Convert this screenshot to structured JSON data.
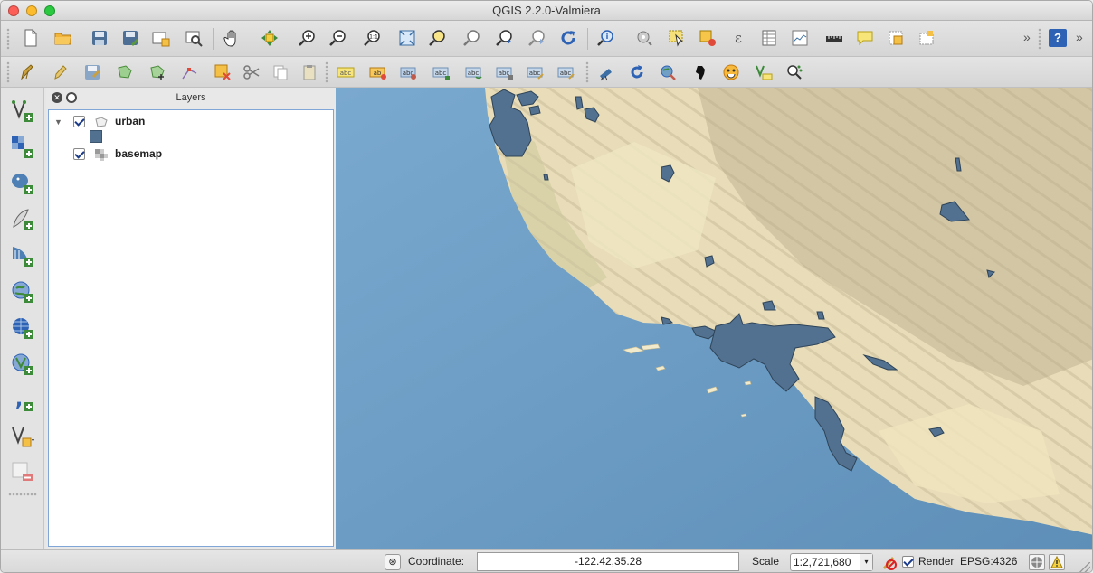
{
  "window": {
    "title": "QGIS 2.2.0-Valmiera"
  },
  "toolbar": {
    "overflow_glyph": "»",
    "help_glyph": "?"
  },
  "layers_panel": {
    "title": "Layers",
    "layers": [
      {
        "name": "urban",
        "checked": true,
        "expanded": true
      },
      {
        "name": "basemap",
        "checked": true,
        "expanded": false
      }
    ]
  },
  "statusbar": {
    "coordinate_label": "Coordinate:",
    "coordinate_value": "-122.42,35.28",
    "scale_label": "Scale",
    "scale_value": "1:2,721,680",
    "render_label": "Render",
    "render_checked": true,
    "crs": "EPSG:4326"
  },
  "colors": {
    "urban_fill": "#52708f",
    "ocean": "#6f9fc5",
    "land": "#e9dfbe",
    "accent": "#1a3a8a"
  }
}
